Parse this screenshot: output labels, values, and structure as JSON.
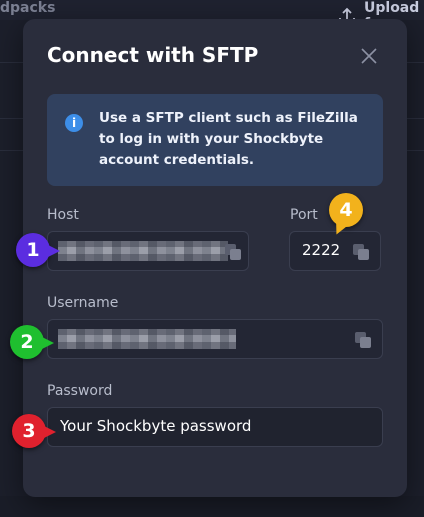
{
  "background": {
    "left_text": "dpacks",
    "upload_label": "Upload f"
  },
  "modal": {
    "title": "Connect with SFTP",
    "info_text": "Use a SFTP client such as FileZilla to log in with your Shockbyte account credentials.",
    "fields": {
      "host_label": "Host",
      "port_label": "Port",
      "port_value": "2222",
      "username_label": "Username",
      "password_label": "Password",
      "password_value": "Your Shockbyte password"
    }
  },
  "annotations": {
    "badge_1": "1",
    "badge_2": "2",
    "badge_3": "3",
    "badge_4": "4"
  },
  "colors": {
    "badge_1": "#5b2de0",
    "badge_2": "#1fbf2f",
    "badge_3": "#e0212e",
    "badge_4": "#f2b21c",
    "info_accent": "#3d8ee8"
  }
}
